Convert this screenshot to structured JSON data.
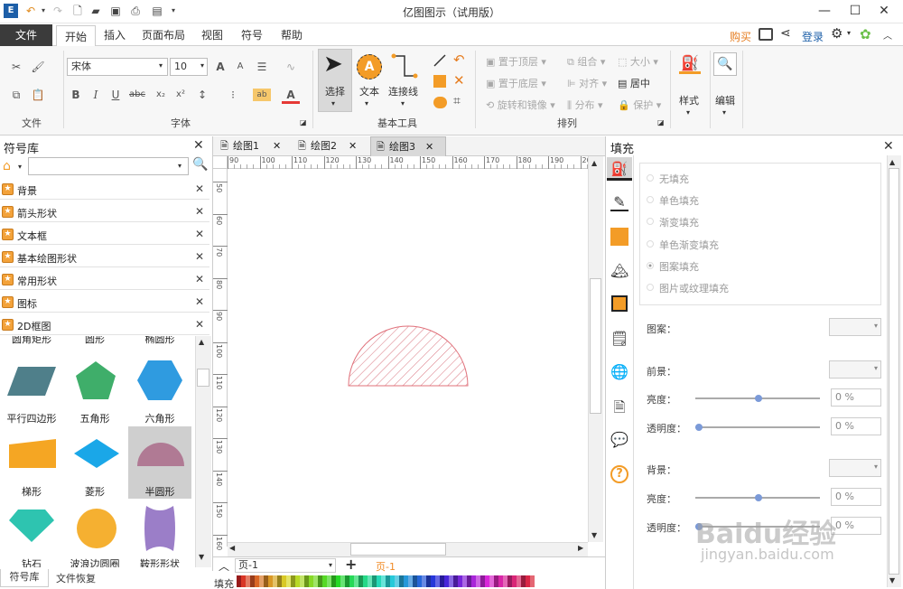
{
  "title": "亿图图示（试用版）",
  "menu": {
    "file": "文件",
    "tabs": [
      "开始",
      "插入",
      "页面布局",
      "视图",
      "符号",
      "帮助"
    ],
    "buy": "购买",
    "login": "登录"
  },
  "ribbon": {
    "file_group": "文件",
    "font_name": "宋体",
    "font_size": "10",
    "font_group": "字体",
    "select": "选择",
    "text": "文本",
    "connector": "连接线",
    "basic_tools": "基本工具",
    "bring_top": "置于顶层",
    "send_bottom": "置于底层",
    "rotate_mirror": "旋转和镜像",
    "group": "组合",
    "align": "对齐",
    "distribute": "分布",
    "size": "大小",
    "center": "居中",
    "protect": "保护",
    "arrange_group": "排列",
    "style": "样式",
    "edit": "编辑"
  },
  "left_panel": {
    "title": "符号库",
    "search_placeholder": "",
    "categories": [
      "背景",
      "箭头形状",
      "文本框",
      "基本绘图形状",
      "常用形状",
      "图标",
      "2D框图"
    ],
    "top_labels": [
      "圆角矩形",
      "圆形",
      "椭圆形"
    ],
    "shapes": [
      {
        "label": "平行四边形",
        "color": "#4f7f8a"
      },
      {
        "label": "五角形",
        "color": "#3fae6a"
      },
      {
        "label": "六角形",
        "color": "#2f9be0"
      },
      {
        "label": "梯形",
        "color": "#f5a623"
      },
      {
        "label": "菱形",
        "color": "#1aa7e8"
      },
      {
        "label": "半圆形",
        "color": "#b07a94"
      },
      {
        "label": "钻石",
        "color": "#2ec4b0"
      },
      {
        "label": "波浪边圆圈",
        "color": "#f5b031"
      },
      {
        "label": "鞍形形状",
        "color": "#9b7ec8"
      }
    ],
    "bottom_tabs": [
      "符号库",
      "文件恢复"
    ]
  },
  "doc_tabs": [
    "绘图1",
    "绘图2",
    "绘图3"
  ],
  "ruler_h": [
    "100",
    "110",
    "120",
    "130",
    "140",
    "150",
    "160",
    "170",
    "180",
    "190",
    "200"
  ],
  "ruler_v": [
    "50",
    "60",
    "70",
    "80",
    "90",
    "100",
    "110",
    "120",
    "130",
    "140",
    "150",
    "160"
  ],
  "ruler_h_start": "90",
  "page_bar": {
    "page_select": "页-1",
    "add": "+",
    "current_page": "页-1"
  },
  "fill_label": "填充",
  "right_panel": {
    "title": "填充",
    "options": [
      "无填充",
      "单色填充",
      "渐变填充",
      "单色渐变填充",
      "图案填充",
      "图片或纹理填充"
    ],
    "pattern_label": "图案：",
    "foreground_label": "前景：",
    "brightness_label": "亮度：",
    "transparency_label": "透明度：",
    "background_label": "背景：",
    "fg_brightness": "0 %",
    "fg_transparency": "0 %",
    "bg_brightness": "0 %",
    "bg_transparency": "0 %"
  },
  "watermark": "Baidu经验",
  "watermark_url": "jingyan.baidu.com",
  "colors": {
    "accent": "#f08a24",
    "semicircle_stroke": "#e0707a"
  }
}
